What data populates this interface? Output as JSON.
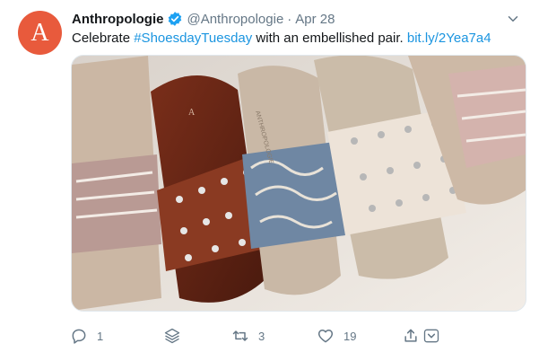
{
  "tweet": {
    "avatar_letter": "A",
    "display_name": "Anthropologie",
    "handle": "@Anthropologie",
    "separator": "·",
    "date": "Apr 28",
    "text_before": "Celebrate ",
    "hashtag": "#ShoesdayTuesday",
    "text_middle": " with an embellished pair. ",
    "link": "bit.ly/2Yea7a4",
    "media_brand_text": "ANTHROPOLOGIE",
    "media_logo_letter": "A"
  },
  "actions": {
    "reply_count": "1",
    "retweet_count": "3",
    "like_count": "19"
  },
  "icons": {
    "verified": "verified-badge-icon",
    "caret": "chevron-down-icon",
    "reply": "reply-icon",
    "layers": "layers-icon",
    "retweet": "retweet-icon",
    "like": "heart-icon",
    "share": "share-icon",
    "more": "chevron-down-circle-icon"
  },
  "colors": {
    "link": "#1b95e0",
    "verified": "#1da1f2",
    "avatar": "#e85a3c",
    "action_gray": "#657786"
  }
}
